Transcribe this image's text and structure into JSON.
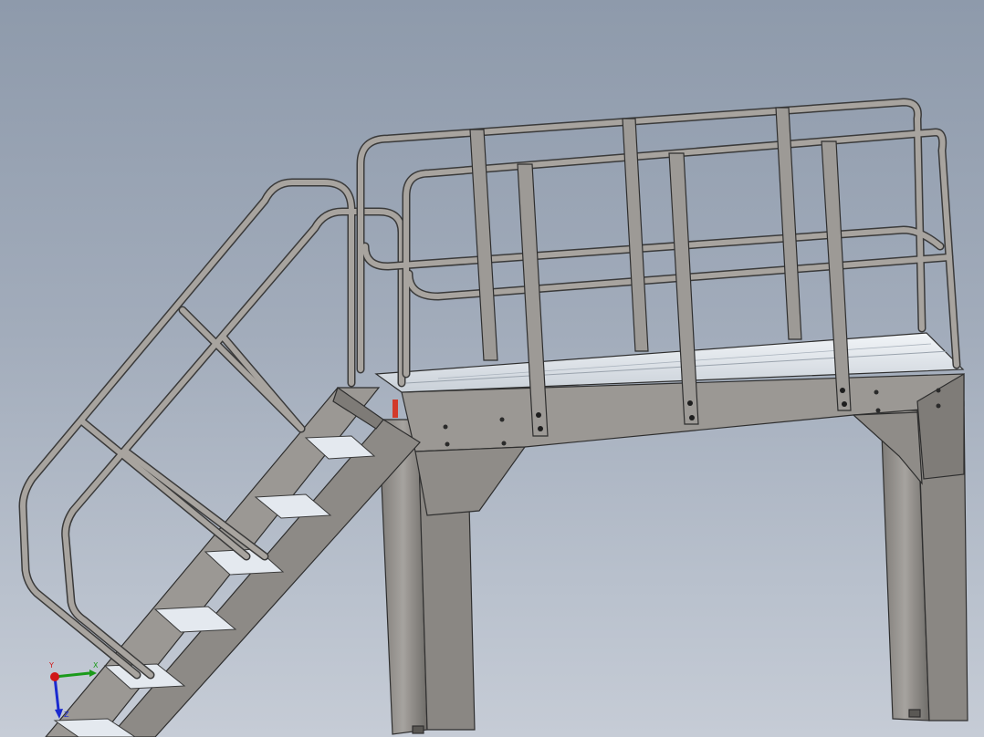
{
  "viewport": {
    "model": "stair-platform-assembly",
    "colors": {
      "background_top": "#8e9aab",
      "background_bottom": "#c6ccd6",
      "steel": "#8f8c88",
      "steel_edge": "#3a3a3a",
      "tread": "#e4e9ef",
      "rail": "#9a9691",
      "highlight_red": "#d23a2a"
    }
  },
  "triad": {
    "x_label": "X",
    "y_label": "Y",
    "z_label": "Z",
    "x_color": "#1a9a1a",
    "y_color": "#d01818",
    "z_color": "#1a2ad0"
  }
}
